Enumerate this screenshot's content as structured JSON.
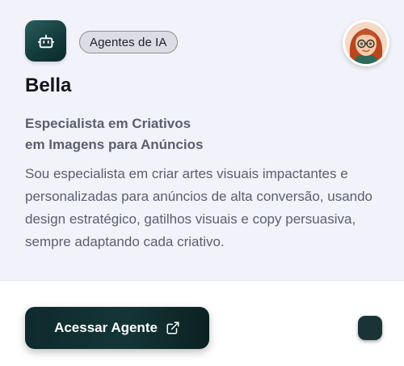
{
  "card": {
    "tag": "Agentes de IA",
    "name": "Bella",
    "subtitle_line1": "Especialista em Criativos",
    "subtitle_line2": "em Imagens para Anúncios",
    "description": "Sou especialista em criar artes visuais impactantes e personalizadas para anúncios de alta conversão, usando design estratégico, gatilhos visuais e copy persuasiva, sempre adaptando cada criativo.",
    "button_label": "Acessar Agente",
    "icons": {
      "agent": "robot-icon",
      "avatar": "cartoon-woman-avatar",
      "button": "external-link-icon"
    },
    "colors": {
      "card_background": "#f2f2fb",
      "button_background": "#143536",
      "text_muted": "#5b5e70",
      "title": "#121420"
    }
  }
}
